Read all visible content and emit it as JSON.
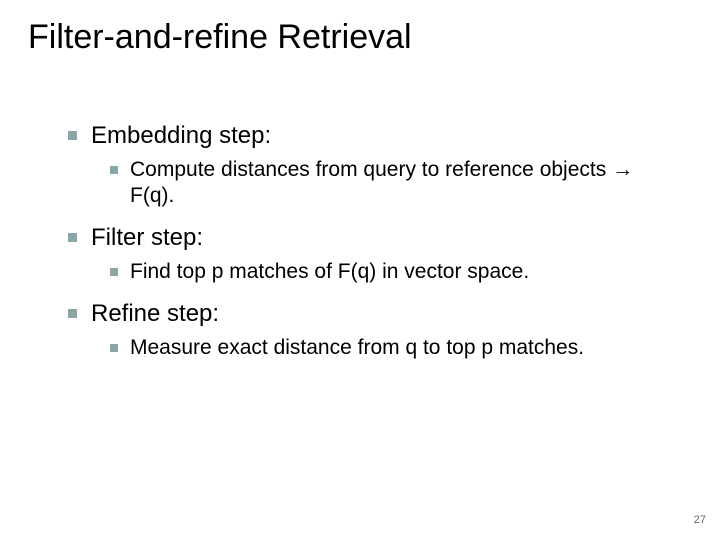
{
  "slide": {
    "title": "Filter-and-refine Retrieval",
    "items": [
      {
        "label": "Embedding step:",
        "sub": {
          "pre": "Compute distances from query to reference objects ",
          "arrow": "→",
          "post": " F(q)."
        }
      },
      {
        "label": "Filter step:",
        "sub": {
          "pre": "Find top p matches of F(q) in vector space.",
          "arrow": "",
          "post": ""
        }
      },
      {
        "label": "Refine step:",
        "sub": {
          "pre": "Measure exact distance from q to top p matches.",
          "arrow": "",
          "post": ""
        }
      }
    ],
    "page_number": "27"
  }
}
